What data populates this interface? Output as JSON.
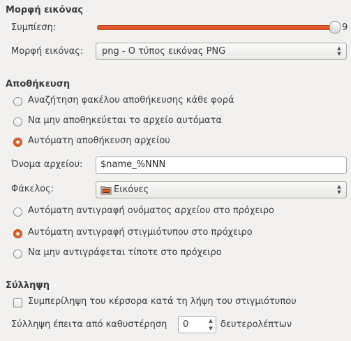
{
  "image_format_section": {
    "title": "Μορφή εικόνας",
    "compression_label": "Συμπίεση:",
    "compression_value": "9",
    "compression_level": 9,
    "format_label": "Μορφή εικόνας:",
    "format_value": "png - Ο τύπος εικόνας PNG"
  },
  "save_section": {
    "title": "Αποθήκευση",
    "options": [
      {
        "label": "Αναζήτηση φακέλου αποθήκευσης κάθε φορά",
        "checked": false
      },
      {
        "label": "Να μην αποθηκεύεται το αρχείο αυτόματα",
        "checked": false
      },
      {
        "label": "Αυτόματη αποθήκευση αρχείου",
        "checked": true
      }
    ],
    "filename_label": "Όνομα αρχείου:",
    "filename_value": "$name_%NNN",
    "folder_label": "Φάκελος:",
    "folder_value": "Εικόνες",
    "clipboard_options": [
      {
        "label": "Αυτόματη αντιγραφή ονόματος αρχείου στο πρόχειρο",
        "checked": false
      },
      {
        "label": "Αυτόματη αντιγραφή στιγμιότυπου στο πρόχειρο",
        "checked": true
      },
      {
        "label": "Να μην αντιγράφεται τίποτε στο πρόχειρο",
        "checked": false
      }
    ]
  },
  "capture_section": {
    "title": "Σύλληψη",
    "include_cursor_label": "Συμπερίληψη του κέρσορα κατά τη λήψη του στιγμιότυπου",
    "include_cursor_checked": false,
    "delay_label": "Σύλληψη έπειτα από καθυστέρηση",
    "delay_value": "0",
    "delay_unit": "δευτερολέπτων"
  },
  "colors": {
    "accent": "#e0592a",
    "background": "#f2f1f0"
  }
}
